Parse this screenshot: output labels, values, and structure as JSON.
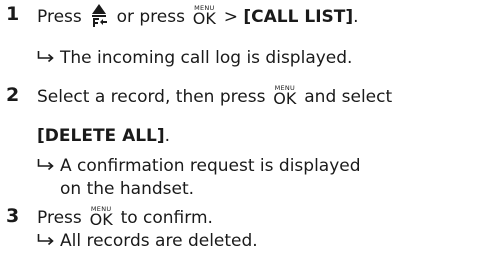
{
  "steps": [
    {
      "number": "1",
      "text_before_icon": "Press",
      "text_between": "or press",
      "key_menu": "MENU",
      "key_ok": "OK",
      "separator": ">",
      "bold_label": "[CALL LIST]",
      "period": ".",
      "result": "The incoming call log is displayed."
    },
    {
      "number": "2",
      "text_before_key": "Select a record, then press",
      "key_menu": "MENU",
      "key_ok": "OK",
      "text_after_key": "and select",
      "bold_label": "[DELETE ALL]",
      "period": ".",
      "result_line1": "A confirmation request is displayed",
      "result_line2": "on the handset."
    },
    {
      "number": "3",
      "text_before_key": "Press",
      "key_menu": "MENU",
      "key_ok": "OK",
      "text_after_key": "to confirm.",
      "result": "All records are deleted."
    }
  ],
  "icons": {
    "call_log_key": "call-list-up-icon",
    "result_arrow": "result-arrow-icon"
  }
}
